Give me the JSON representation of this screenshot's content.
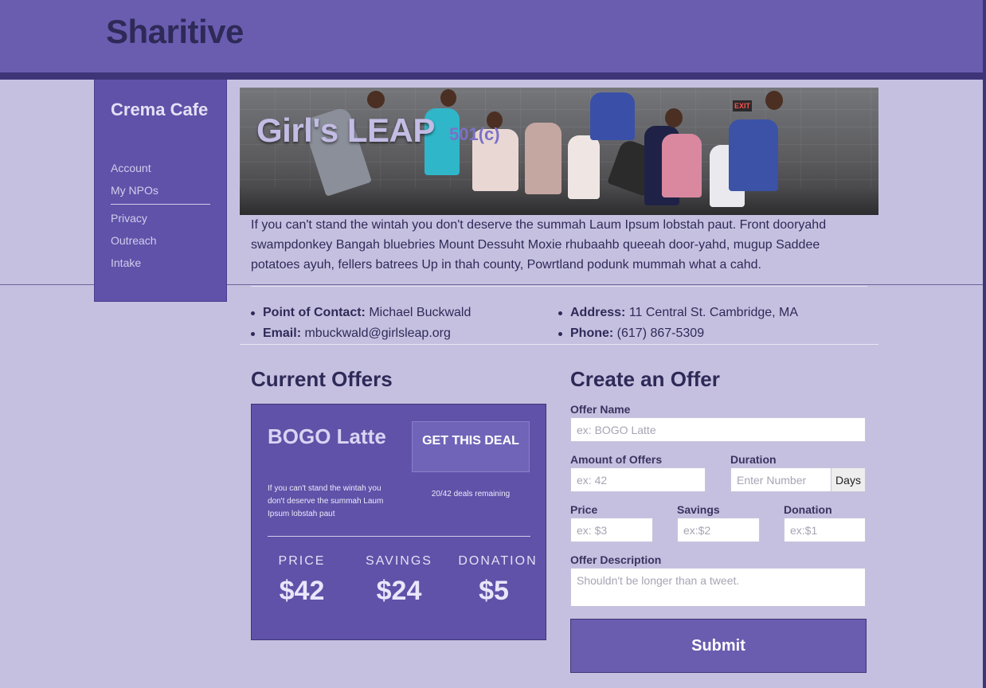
{
  "app": {
    "brand": "Sharitive"
  },
  "sidebar": {
    "title": "Crema Cafe",
    "items": [
      {
        "label": "Account"
      },
      {
        "label": "My NPOs"
      },
      {
        "label": "Privacy"
      },
      {
        "label": "Outreach"
      },
      {
        "label": "Intake"
      }
    ]
  },
  "org": {
    "name": "Girl's LEAP",
    "badge": "501(c)",
    "exit_sign": "EXIT",
    "description": "If you can't stand the wintah you don't deserve the summah Laum Ipsum lobstah paut. Front dooryahd swampdonkey Bangah bluebries Mount Dessuht Moxie rhubaahb queeah door-yahd, mugup Saddee potatoes ayuh, fellers batrees Up in thah county, Powrtland podunk mummah what a cahd.",
    "contact_label": "Point of Contact:",
    "contact_value": "Michael Buckwald",
    "email_label": "Email:",
    "email_value": "mbuckwald@girlsleap.org",
    "address_label": "Address:",
    "address_value": "11 Central St. Cambridge, MA",
    "phone_label": "Phone:",
    "phone_value": "(617) 867-5309"
  },
  "offers": {
    "heading": "Current Offers",
    "items": [
      {
        "name": "BOGO Latte",
        "cta": "GET THIS DEAL",
        "description": "If you can't stand the wintah you don't deserve the summah Laum Ipsum lobstah paut",
        "remaining": "20/42 deals remaining",
        "price_label": "PRICE",
        "price": "$42",
        "savings_label": "SAVINGS",
        "savings": "$24",
        "donation_label": "DONATION",
        "donation": "$5"
      }
    ]
  },
  "form": {
    "heading": "Create an Offer",
    "offer_name_label": "Offer Name",
    "offer_name_placeholder": "ex: BOGO Latte",
    "amount_label": "Amount of Offers",
    "amount_placeholder": "ex: 42",
    "duration_label": "Duration",
    "duration_placeholder": "Enter Number",
    "duration_unit": "Days",
    "price_label": "Price",
    "price_placeholder": "ex: $3",
    "savings_label": "Savings",
    "savings_placeholder": "ex:$2",
    "donation_label": "Donation",
    "donation_placeholder": "ex:$1",
    "description_label": "Offer Description",
    "description_placeholder": "Shouldn't be longer than a tweet.",
    "submit_label": "Submit"
  },
  "colors": {
    "header": "#6a5db0",
    "background": "#c6c0e0",
    "card": "#5f52a8",
    "accent_dark": "#3e3578"
  }
}
